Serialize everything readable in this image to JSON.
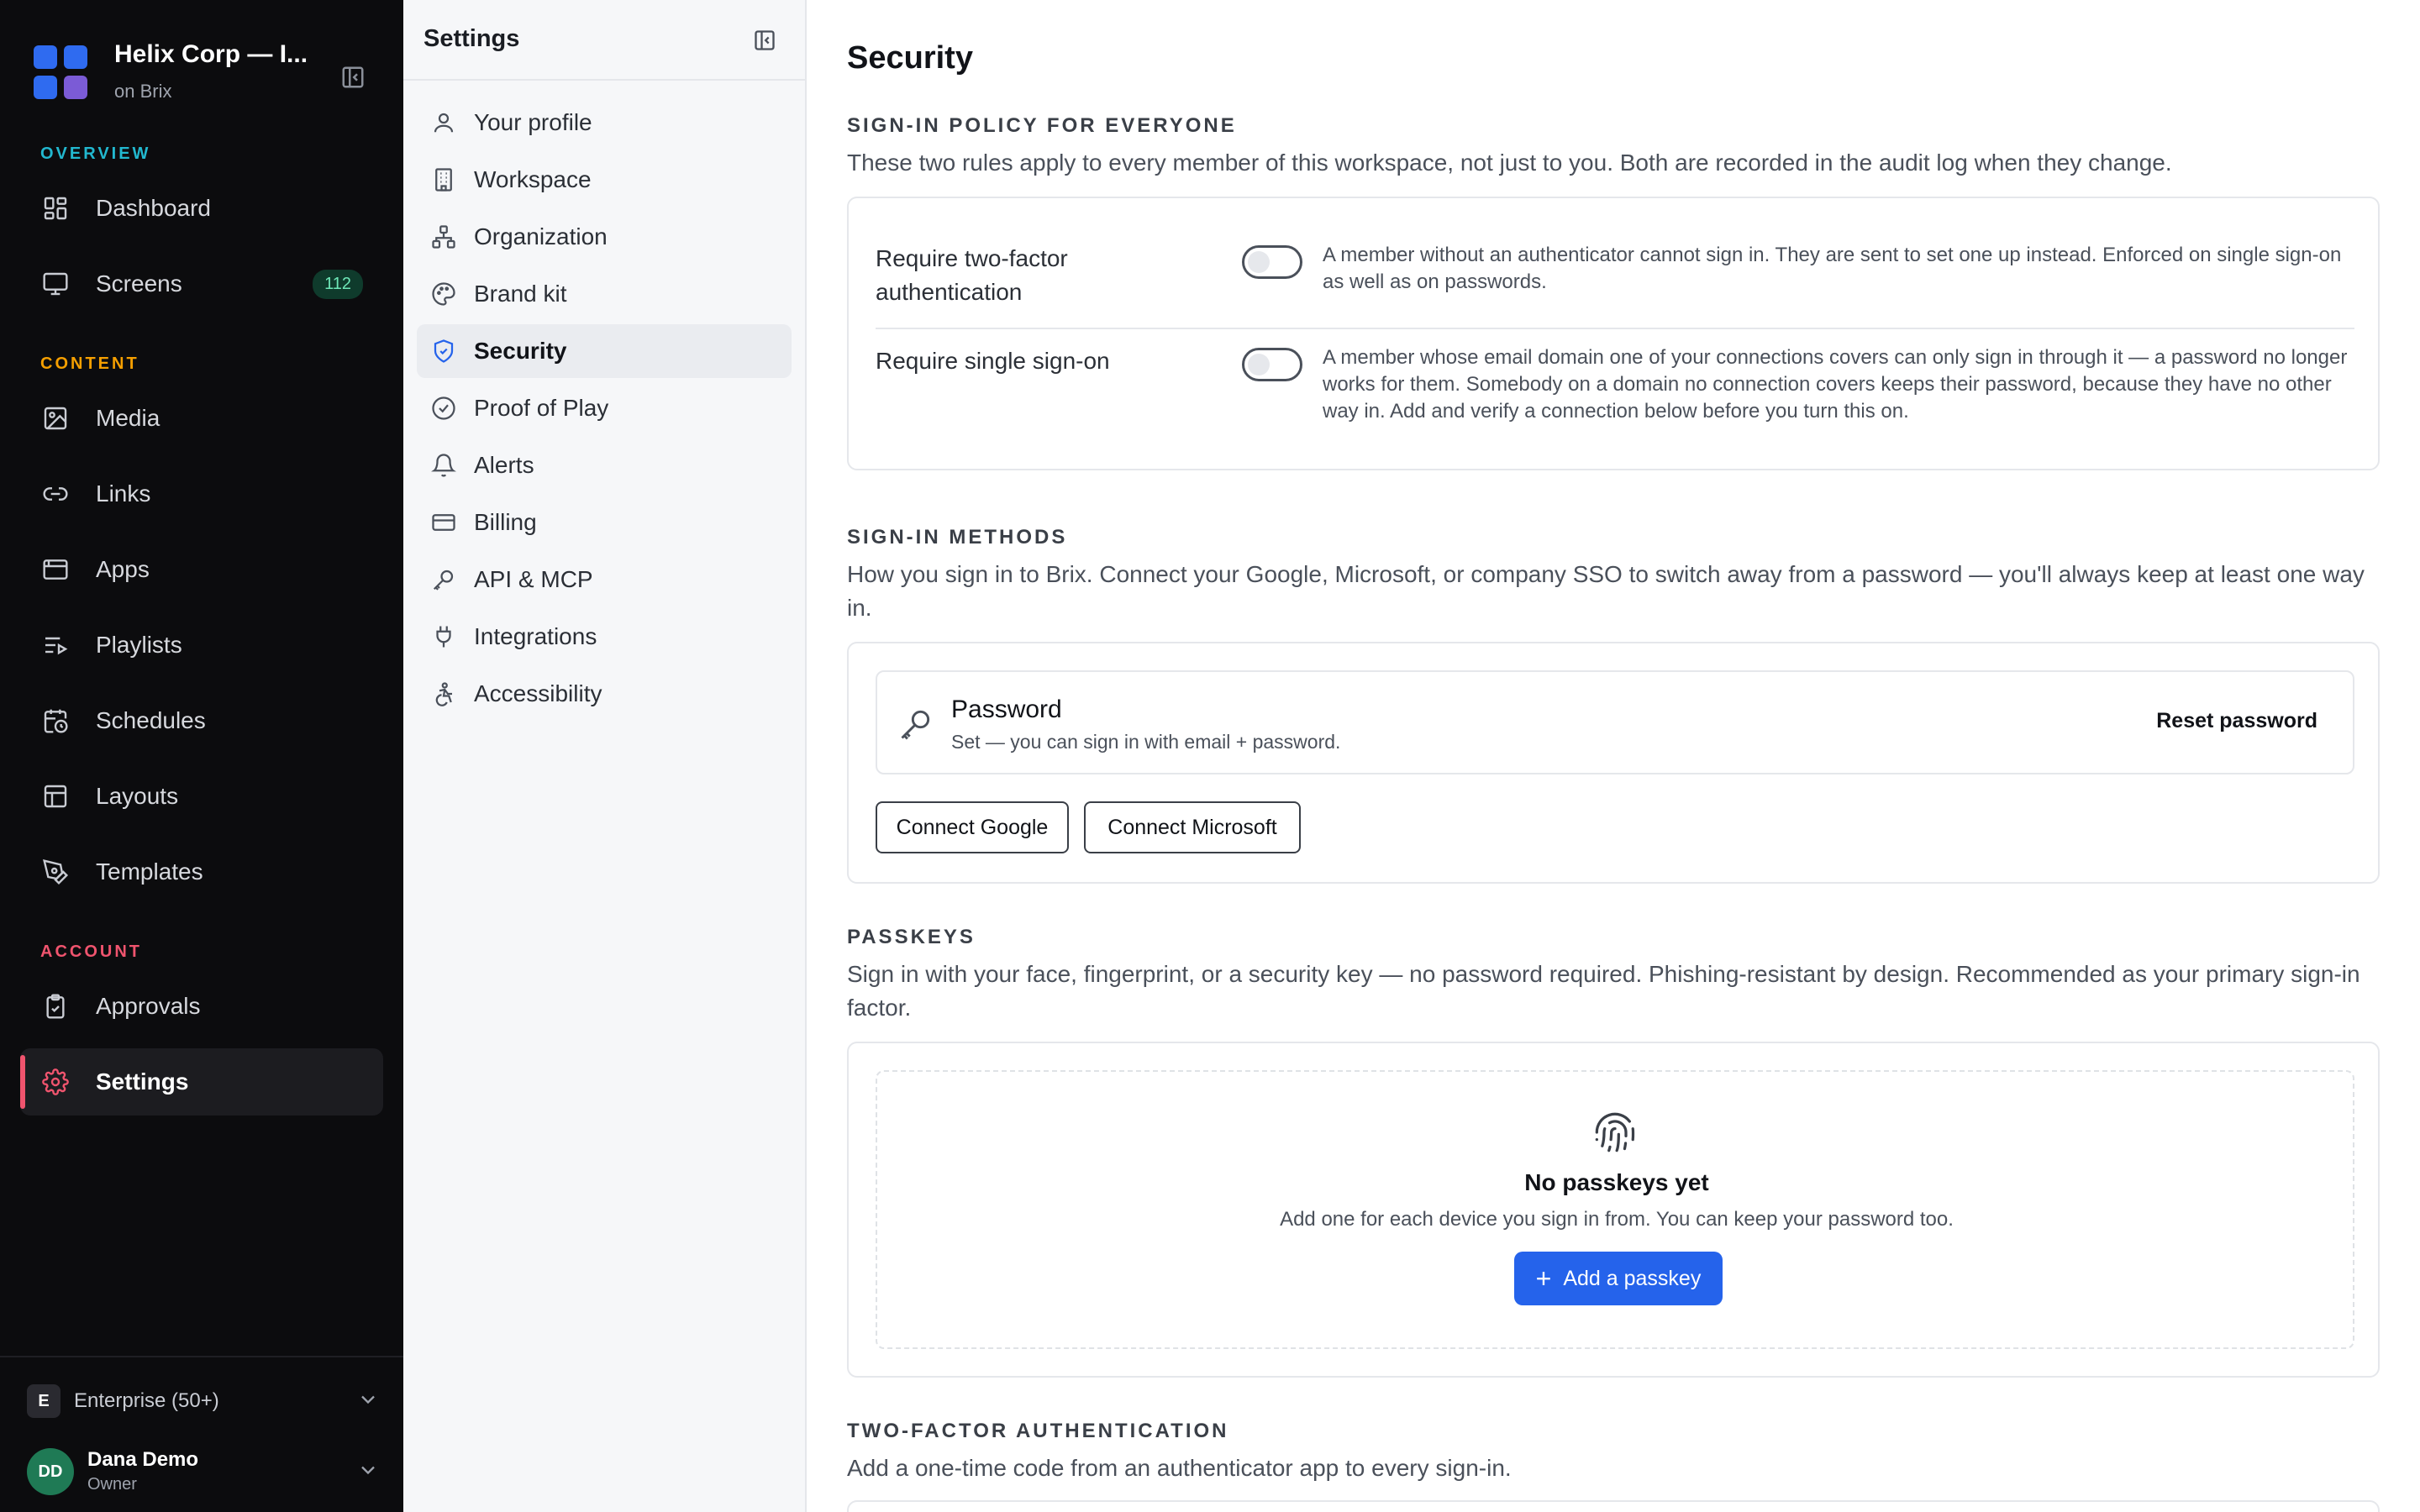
{
  "workspace": {
    "name": "Helix Corp — I...",
    "platform": "on Brix"
  },
  "sidebar": {
    "sections": [
      {
        "label": "OVERVIEW",
        "color": "#22b8cf"
      },
      {
        "label": "CONTENT",
        "color": "#f59f00"
      },
      {
        "label": "ACCOUNT",
        "color": "#f0546e"
      }
    ],
    "items": [
      {
        "label": "Dashboard",
        "icon": "dashboard-icon"
      },
      {
        "label": "Screens",
        "icon": "monitor-icon",
        "badge": "112"
      },
      {
        "label": "Media",
        "icon": "image-icon"
      },
      {
        "label": "Links",
        "icon": "link-icon"
      },
      {
        "label": "Apps",
        "icon": "app-window-icon"
      },
      {
        "label": "Playlists",
        "icon": "playlist-icon"
      },
      {
        "label": "Schedules",
        "icon": "calendar-clock-icon"
      },
      {
        "label": "Layouts",
        "icon": "layout-icon"
      },
      {
        "label": "Templates",
        "icon": "pen-tool-icon"
      },
      {
        "label": "Approvals",
        "icon": "clipboard-check-icon"
      },
      {
        "label": "Settings",
        "icon": "gear-icon",
        "active": true
      }
    ],
    "plan": {
      "chip": "E",
      "label": "Enterprise (50+)"
    },
    "user": {
      "initials": "DD",
      "name": "Dana Demo",
      "role": "Owner"
    }
  },
  "settings_nav": {
    "title": "Settings",
    "items": [
      {
        "label": "Your profile",
        "icon": "user-icon"
      },
      {
        "label": "Workspace",
        "icon": "building-icon"
      },
      {
        "label": "Organization",
        "icon": "org-chart-icon"
      },
      {
        "label": "Brand kit",
        "icon": "palette-icon"
      },
      {
        "label": "Security",
        "icon": "shield-check-icon",
        "active": true
      },
      {
        "label": "Proof of Play",
        "icon": "check-circle-icon"
      },
      {
        "label": "Alerts",
        "icon": "bell-icon"
      },
      {
        "label": "Billing",
        "icon": "credit-card-icon"
      },
      {
        "label": "API & MCP",
        "icon": "key-icon"
      },
      {
        "label": "Integrations",
        "icon": "plug-icon"
      },
      {
        "label": "Accessibility",
        "icon": "accessibility-icon"
      }
    ]
  },
  "page": {
    "title": "Security",
    "policy": {
      "heading": "SIGN-IN POLICY FOR EVERYONE",
      "description": "These two rules apply to every member of this workspace, not just to you. Both are recorded in the audit log when they change.",
      "rules": [
        {
          "label": "Require two-factor authentication",
          "enabled": false,
          "help": "A member without an authenticator cannot sign in. They are sent to set one up instead. Enforced on single sign-on as well as on passwords."
        },
        {
          "label": "Require single sign-on",
          "enabled": false,
          "help": "A member whose email domain one of your connections covers can only sign in through it — a password no longer works for them. Somebody on a domain no connection covers keeps their password, because they have no other way in. Add and verify a connection below before you turn this on."
        }
      ]
    },
    "methods": {
      "heading": "SIGN-IN METHODS",
      "description": "How you sign in to Brix. Connect your Google, Microsoft, or company SSO to switch away from a password — you'll always keep at least one way in.",
      "password_title": "Password",
      "password_status": "Set — you can sign in with email + password.",
      "reset_label": "Reset password",
      "connect_google": "Connect Google",
      "connect_microsoft": "Connect Microsoft"
    },
    "passkeys": {
      "heading": "PASSKEYS",
      "description": "Sign in with your face, fingerprint, or a security key — no password required. Phishing-resistant by design. Recommended as your primary sign-in factor.",
      "empty_title": "No passkeys yet",
      "empty_sub": "Add one for each device you sign in from. You can keep your password too.",
      "add_label": "Add a passkey"
    },
    "two_factor": {
      "heading": "TWO-FACTOR AUTHENTICATION",
      "description": "Add a one-time code from an authenticator app to every sign-in."
    }
  },
  "colors": {
    "accent": "#2563eb",
    "active_marker": "#f0546e",
    "badge_text": "#6ee7b7"
  }
}
